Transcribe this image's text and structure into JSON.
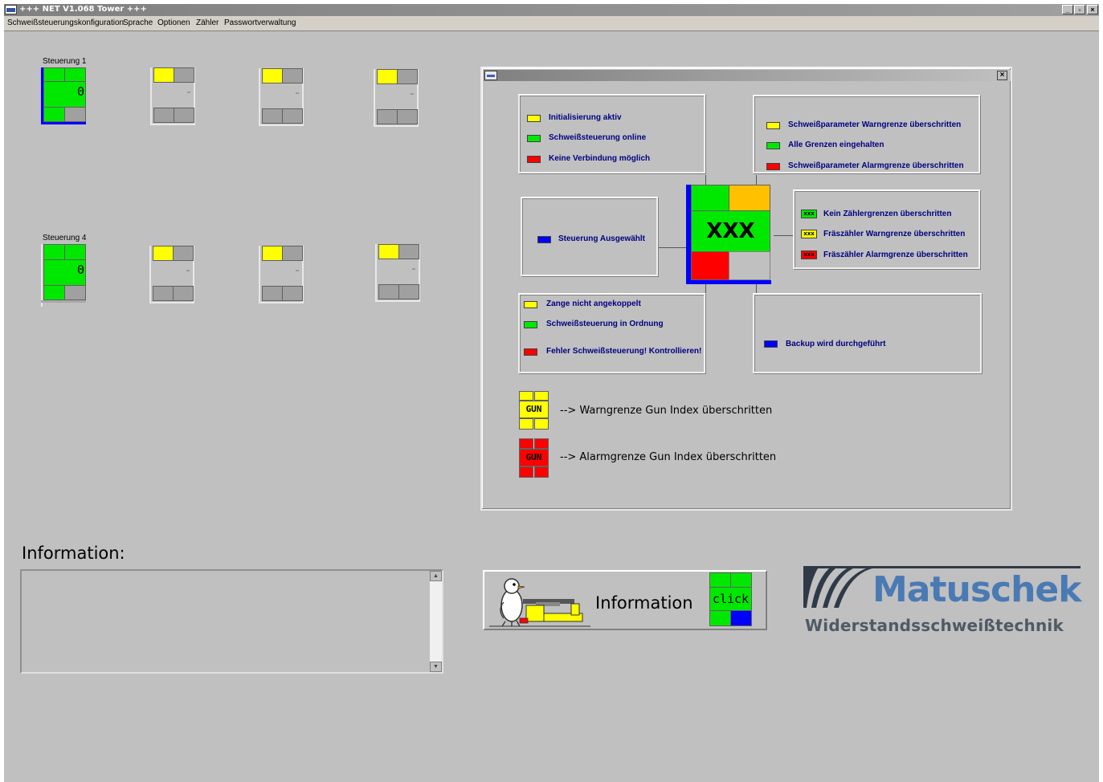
{
  "window": {
    "title": "+++ NET V1.068 Tower +++",
    "buttons": [
      "_",
      "▫",
      "×"
    ]
  },
  "menu": [
    {
      "label": "Schweißsteuerungskonfiguration"
    },
    {
      "label": "Sprache"
    },
    {
      "label": "Optionen"
    },
    {
      "label": "Zähler"
    },
    {
      "label": "Passwortverwaltung"
    }
  ],
  "controllers": [
    {
      "label": "Steuerung 1",
      "counter": "0",
      "selected": true
    },
    {
      "label": "Steuerung 4",
      "counter": "0",
      "selected": false
    }
  ],
  "colors": {
    "green": "#00e800",
    "yellow": "#ffff00",
    "red": "#ff0000",
    "blue": "#0000ff",
    "orange": "#ffc000",
    "gray": "#a0a0a0",
    "window_bg": "#c0c0c0",
    "brand": "#4a7ab4"
  },
  "legend": {
    "close": "×",
    "center_label": "XXX",
    "status_box": [
      {
        "color": "yellow",
        "text": "Initialisierung aktiv"
      },
      {
        "color": "green",
        "text": "Schweißsteuerung online"
      },
      {
        "color": "red",
        "text": "Keine Verbindung möglich"
      }
    ],
    "param_box": [
      {
        "color": "yellow",
        "text": "Schweißparameter Warngrenze überschritten"
      },
      {
        "color": "green",
        "text": "Alle Grenzen eingehalten"
      },
      {
        "color": "red",
        "text": "Schweißparameter Alarmgrenze überschritten"
      }
    ],
    "select_box": [
      {
        "color": "blue",
        "text": "Steuerung Ausgewählt"
      }
    ],
    "counter_box": [
      {
        "color": "green",
        "swatch": "xxx",
        "text": "Kein Zählergrenzen überschritten"
      },
      {
        "color": "yellow",
        "swatch": "xxx",
        "text": "Fräszähler Warngrenze überschritten"
      },
      {
        "color": "red",
        "swatch": "xxx",
        "text": "Fräszähler Alarmgrenze überschritten"
      }
    ],
    "gun_box": [
      {
        "color": "yellow",
        "text": "Zange nicht angekoppelt"
      },
      {
        "color": "green",
        "text": "Schweißsteuerung in Ordnung"
      },
      {
        "color": "red",
        "text": "Fehler Schweißsteuerung! Kontrollieren!"
      }
    ],
    "backup_box": [
      {
        "color": "blue",
        "text": "Backup wird durchgeführt"
      }
    ],
    "gun_index": [
      {
        "color": "yellow",
        "badge": "GUN",
        "text": "--> Warngrenze Gun Index überschritten"
      },
      {
        "color": "red",
        "badge": "GUN",
        "text": "--> Alarmgrenze Gun Index überschritten"
      }
    ]
  },
  "info": {
    "label": "Information:",
    "text": "",
    "button_label": "Information",
    "click_label": "click"
  },
  "logo": {
    "brand": "Matuschek",
    "subtitle": "Widerstandsschweißtechnik"
  }
}
